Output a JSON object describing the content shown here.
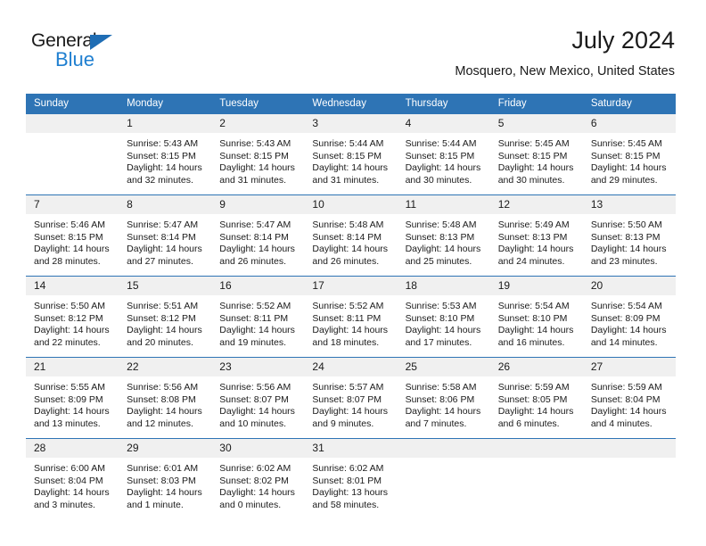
{
  "brand": {
    "word_one": "General",
    "word_two": "Blue",
    "triangle_color": "#1f6db4",
    "blue_color": "#1f7fd0"
  },
  "header": {
    "title": "July 2024",
    "subtitle": "Mosquero, New Mexico, United States"
  },
  "theme": {
    "header_bg": "#2e74b5",
    "header_text": "#ffffff",
    "daynum_bg": "#f0f0f0",
    "grid_line": "#2e74b5",
    "page_bg": "#ffffff",
    "body_text": "#1a1a1a"
  },
  "calendar": {
    "columns": [
      "Sunday",
      "Monday",
      "Tuesday",
      "Wednesday",
      "Thursday",
      "Friday",
      "Saturday"
    ],
    "labels": {
      "sunrise": "Sunrise:",
      "sunset": "Sunset:",
      "daylight": "Daylight:"
    },
    "weeks": [
      [
        {
          "day": "",
          "sunrise": "",
          "sunset": "",
          "daylight": ""
        },
        {
          "day": "1",
          "sunrise": "Sunrise: 5:43 AM",
          "sunset": "Sunset: 8:15 PM",
          "daylight": "Daylight: 14 hours and 32 minutes."
        },
        {
          "day": "2",
          "sunrise": "Sunrise: 5:43 AM",
          "sunset": "Sunset: 8:15 PM",
          "daylight": "Daylight: 14 hours and 31 minutes."
        },
        {
          "day": "3",
          "sunrise": "Sunrise: 5:44 AM",
          "sunset": "Sunset: 8:15 PM",
          "daylight": "Daylight: 14 hours and 31 minutes."
        },
        {
          "day": "4",
          "sunrise": "Sunrise: 5:44 AM",
          "sunset": "Sunset: 8:15 PM",
          "daylight": "Daylight: 14 hours and 30 minutes."
        },
        {
          "day": "5",
          "sunrise": "Sunrise: 5:45 AM",
          "sunset": "Sunset: 8:15 PM",
          "daylight": "Daylight: 14 hours and 30 minutes."
        },
        {
          "day": "6",
          "sunrise": "Sunrise: 5:45 AM",
          "sunset": "Sunset: 8:15 PM",
          "daylight": "Daylight: 14 hours and 29 minutes."
        }
      ],
      [
        {
          "day": "7",
          "sunrise": "Sunrise: 5:46 AM",
          "sunset": "Sunset: 8:15 PM",
          "daylight": "Daylight: 14 hours and 28 minutes."
        },
        {
          "day": "8",
          "sunrise": "Sunrise: 5:47 AM",
          "sunset": "Sunset: 8:14 PM",
          "daylight": "Daylight: 14 hours and 27 minutes."
        },
        {
          "day": "9",
          "sunrise": "Sunrise: 5:47 AM",
          "sunset": "Sunset: 8:14 PM",
          "daylight": "Daylight: 14 hours and 26 minutes."
        },
        {
          "day": "10",
          "sunrise": "Sunrise: 5:48 AM",
          "sunset": "Sunset: 8:14 PM",
          "daylight": "Daylight: 14 hours and 26 minutes."
        },
        {
          "day": "11",
          "sunrise": "Sunrise: 5:48 AM",
          "sunset": "Sunset: 8:13 PM",
          "daylight": "Daylight: 14 hours and 25 minutes."
        },
        {
          "day": "12",
          "sunrise": "Sunrise: 5:49 AM",
          "sunset": "Sunset: 8:13 PM",
          "daylight": "Daylight: 14 hours and 24 minutes."
        },
        {
          "day": "13",
          "sunrise": "Sunrise: 5:50 AM",
          "sunset": "Sunset: 8:13 PM",
          "daylight": "Daylight: 14 hours and 23 minutes."
        }
      ],
      [
        {
          "day": "14",
          "sunrise": "Sunrise: 5:50 AM",
          "sunset": "Sunset: 8:12 PM",
          "daylight": "Daylight: 14 hours and 22 minutes."
        },
        {
          "day": "15",
          "sunrise": "Sunrise: 5:51 AM",
          "sunset": "Sunset: 8:12 PM",
          "daylight": "Daylight: 14 hours and 20 minutes."
        },
        {
          "day": "16",
          "sunrise": "Sunrise: 5:52 AM",
          "sunset": "Sunset: 8:11 PM",
          "daylight": "Daylight: 14 hours and 19 minutes."
        },
        {
          "day": "17",
          "sunrise": "Sunrise: 5:52 AM",
          "sunset": "Sunset: 8:11 PM",
          "daylight": "Daylight: 14 hours and 18 minutes."
        },
        {
          "day": "18",
          "sunrise": "Sunrise: 5:53 AM",
          "sunset": "Sunset: 8:10 PM",
          "daylight": "Daylight: 14 hours and 17 minutes."
        },
        {
          "day": "19",
          "sunrise": "Sunrise: 5:54 AM",
          "sunset": "Sunset: 8:10 PM",
          "daylight": "Daylight: 14 hours and 16 minutes."
        },
        {
          "day": "20",
          "sunrise": "Sunrise: 5:54 AM",
          "sunset": "Sunset: 8:09 PM",
          "daylight": "Daylight: 14 hours and 14 minutes."
        }
      ],
      [
        {
          "day": "21",
          "sunrise": "Sunrise: 5:55 AM",
          "sunset": "Sunset: 8:09 PM",
          "daylight": "Daylight: 14 hours and 13 minutes."
        },
        {
          "day": "22",
          "sunrise": "Sunrise: 5:56 AM",
          "sunset": "Sunset: 8:08 PM",
          "daylight": "Daylight: 14 hours and 12 minutes."
        },
        {
          "day": "23",
          "sunrise": "Sunrise: 5:56 AM",
          "sunset": "Sunset: 8:07 PM",
          "daylight": "Daylight: 14 hours and 10 minutes."
        },
        {
          "day": "24",
          "sunrise": "Sunrise: 5:57 AM",
          "sunset": "Sunset: 8:07 PM",
          "daylight": "Daylight: 14 hours and 9 minutes."
        },
        {
          "day": "25",
          "sunrise": "Sunrise: 5:58 AM",
          "sunset": "Sunset: 8:06 PM",
          "daylight": "Daylight: 14 hours and 7 minutes."
        },
        {
          "day": "26",
          "sunrise": "Sunrise: 5:59 AM",
          "sunset": "Sunset: 8:05 PM",
          "daylight": "Daylight: 14 hours and 6 minutes."
        },
        {
          "day": "27",
          "sunrise": "Sunrise: 5:59 AM",
          "sunset": "Sunset: 8:04 PM",
          "daylight": "Daylight: 14 hours and 4 minutes."
        }
      ],
      [
        {
          "day": "28",
          "sunrise": "Sunrise: 6:00 AM",
          "sunset": "Sunset: 8:04 PM",
          "daylight": "Daylight: 14 hours and 3 minutes."
        },
        {
          "day": "29",
          "sunrise": "Sunrise: 6:01 AM",
          "sunset": "Sunset: 8:03 PM",
          "daylight": "Daylight: 14 hours and 1 minute."
        },
        {
          "day": "30",
          "sunrise": "Sunrise: 6:02 AM",
          "sunset": "Sunset: 8:02 PM",
          "daylight": "Daylight: 14 hours and 0 minutes."
        },
        {
          "day": "31",
          "sunrise": "Sunrise: 6:02 AM",
          "sunset": "Sunset: 8:01 PM",
          "daylight": "Daylight: 13 hours and 58 minutes."
        },
        {
          "day": "",
          "sunrise": "",
          "sunset": "",
          "daylight": ""
        },
        {
          "day": "",
          "sunrise": "",
          "sunset": "",
          "daylight": ""
        },
        {
          "day": "",
          "sunrise": "",
          "sunset": "",
          "daylight": ""
        }
      ]
    ]
  }
}
